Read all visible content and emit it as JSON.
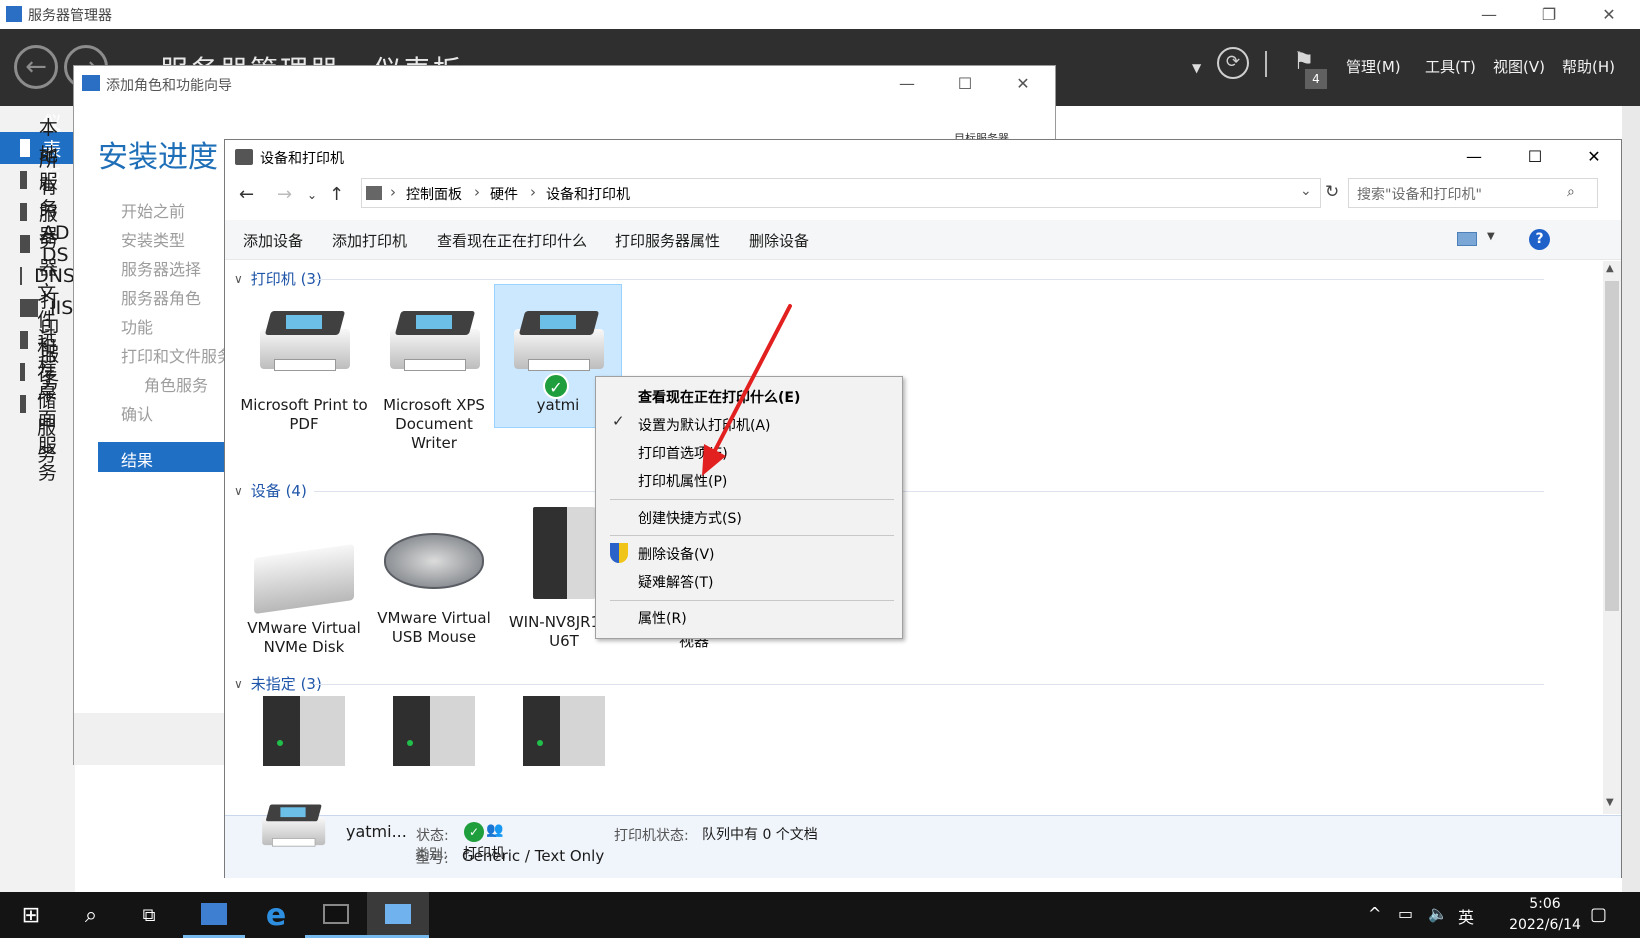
{
  "server_manager": {
    "title": "服务器管理器",
    "breadcrumb": "服务器管理器 · 仪表板",
    "menus": [
      "管理(M)",
      "工具(T)",
      "视图(V)",
      "帮助(H)"
    ],
    "notification_count": "4",
    "sidebar": [
      {
        "label": "仪表板",
        "icon": "dashboard-icon",
        "active": true
      },
      {
        "label": "本地服务器",
        "icon": "server-icon"
      },
      {
        "label": "所有服务器",
        "icon": "servers-icon"
      },
      {
        "label": "AD DS",
        "icon": "ad-icon"
      },
      {
        "label": "DNS",
        "icon": "dns-icon"
      },
      {
        "label": "IIS",
        "icon": "iis-icon"
      },
      {
        "label": "打印服务",
        "icon": "print-icon"
      },
      {
        "label": "文件和存储服务",
        "icon": "file-icon"
      },
      {
        "label": "远程桌面服务",
        "icon": "remote-icon"
      }
    ]
  },
  "wizard": {
    "title": "添加角色和功能向导",
    "heading": "安装进度",
    "target_label": "目标服务器",
    "steps": [
      "开始之前",
      "安装类型",
      "服务器选择",
      "服务器角色",
      "功能",
      "打印和文件服务",
      "角色服务",
      "确认"
    ],
    "active_step": "结果"
  },
  "devices_printers": {
    "title": "设备和打印机",
    "address": [
      "控制面板",
      "硬件",
      "设备和打印机"
    ],
    "search_placeholder": "搜索\"设备和打印机\"",
    "commands": [
      "添加设备",
      "添加打印机",
      "查看现在正在打印什么",
      "打印服务器属性",
      "删除设备"
    ],
    "groups": {
      "printers": {
        "label": "打印机 (3)",
        "items": [
          "Microsoft Print to PDF",
          "Microsoft XPS Document Writer",
          "yatmi"
        ]
      },
      "devices": {
        "label": "设备 (4)",
        "items": [
          "VMware Virtual NVMe Disk",
          "VMware Virtual USB Mouse",
          "WIN-NV8JR19S U6T",
          "通用非即插即用 监视器"
        ]
      },
      "unspecified": {
        "label": "未指定 (3)"
      }
    },
    "details": {
      "name": "yatmi...",
      "status_label": "状态:",
      "model_label": "型号:",
      "model_value": "Generic / Text Only",
      "category_label": "类别:",
      "category_value": "打印机",
      "printer_status_label": "打印机状态:",
      "printer_status_value": "队列中有 0 个文档"
    }
  },
  "context_menu": [
    "查看现在正在打印什么(E)",
    "设置为默认打印机(A)",
    "打印首选项(E)",
    "打印机属性(P)",
    "创建快捷方式(S)",
    "删除设备(V)",
    "疑难解答(T)",
    "属性(R)"
  ],
  "taskbar": {
    "time": "5:06",
    "date": "2022/6/14",
    "ime": "英"
  },
  "colors": {
    "accent": "#1f6fc5",
    "header_bg": "#2f2f2f",
    "selection": "#cce8ff",
    "arrow": "#e32020",
    "ok_green": "#1e9e3c"
  }
}
